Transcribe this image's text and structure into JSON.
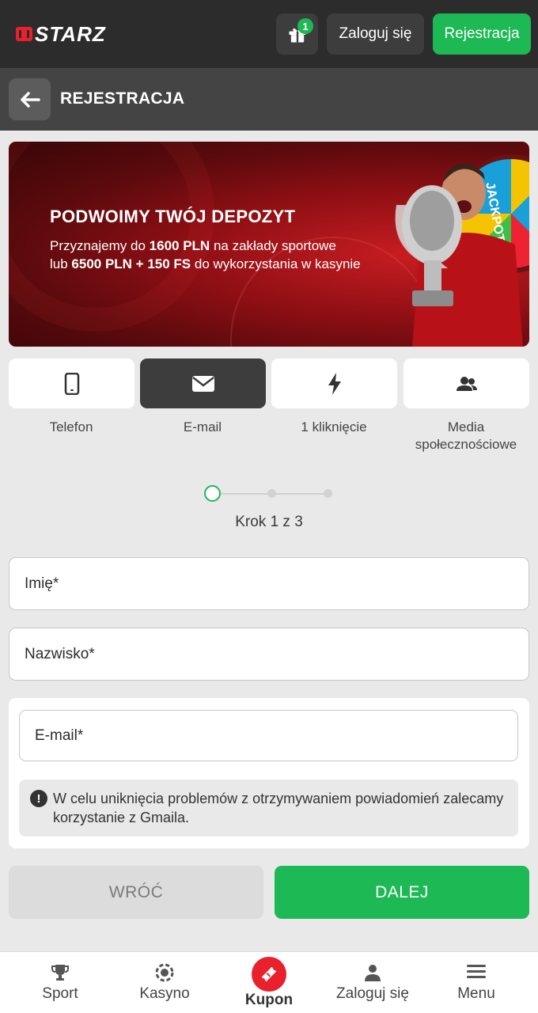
{
  "header": {
    "logo_text": "STARZ",
    "gift_badge_count": "1",
    "login_label": "Zaloguj się",
    "register_label": "Rejestracja"
  },
  "subheader": {
    "title": "REJESTRACJA"
  },
  "banner": {
    "title": "PODWOIMY TWÓJ DEPOZYT",
    "line1_prefix": "Przyznajemy do ",
    "line1_bold": "1600 PLN",
    "line1_suffix": " na zakłady sportowe",
    "line2_prefix": "lub ",
    "line2_bold": "6500 PLN + 150 FS",
    "line2_suffix": " do wykorzystania w kasynie",
    "wheel_text": "JACKPOT"
  },
  "tabs": [
    {
      "label": "Telefon",
      "icon": "phone-icon",
      "active": false
    },
    {
      "label": "E-mail",
      "icon": "envelope-icon",
      "active": true
    },
    {
      "label": "1 kliknięcie",
      "icon": "lightning-icon",
      "active": false
    },
    {
      "label": "Media społecznościowe",
      "icon": "users-icon",
      "active": false
    }
  ],
  "stepper": {
    "current_step": 1,
    "total_steps": 3,
    "label": "Krok 1 z 3"
  },
  "form": {
    "first_name_placeholder": "Imię*",
    "last_name_placeholder": "Nazwisko*",
    "email_placeholder": "E-mail*",
    "notice_text": "W celu uniknięcia problemów z otrzymywaniem powiadomień zalecamy korzystanie z Gmaila."
  },
  "buttons": {
    "back_label": "WRÓĆ",
    "next_label": "DALEJ"
  },
  "bottom_nav": [
    {
      "label": "Sport",
      "icon": "trophy-icon"
    },
    {
      "label": "Kasyno",
      "icon": "casino-chip-icon"
    },
    {
      "label": "Kupon",
      "icon": "ticket-icon"
    },
    {
      "label": "Zaloguj się",
      "icon": "user-icon"
    },
    {
      "label": "Menu",
      "icon": "hamburger-icon"
    }
  ],
  "colors": {
    "accent_green": "#1db954",
    "brand_red": "#e8212d",
    "header_dark": "#2c2c2c",
    "subheader": "#444444"
  }
}
